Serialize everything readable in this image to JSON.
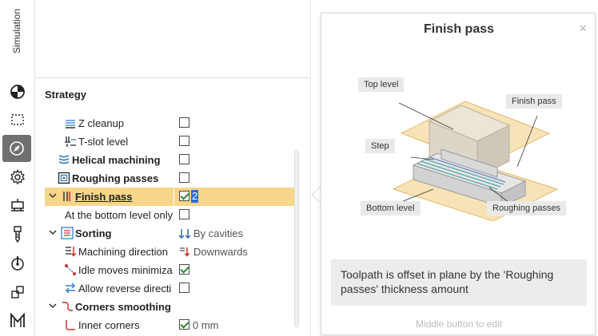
{
  "sidebar": {
    "tab_label": "Simulation",
    "icons": [
      "pie-chart-icon",
      "dashed-rectangle-icon",
      "compass-icon",
      "gear-icon",
      "machine-icon",
      "tool-icon",
      "probe-icon",
      "blocks-icon",
      "m-logo-icon"
    ]
  },
  "panel": {
    "section_title": "Strategy",
    "rows": [
      {
        "label": "Z cleanup",
        "checked": false
      },
      {
        "label": "T-slot level",
        "checked": false
      },
      {
        "label": "Helical machining",
        "checked": false
      },
      {
        "label": "Roughing passes",
        "checked": false
      },
      {
        "label": "Finish pass",
        "checked": true,
        "value": "2"
      },
      {
        "label": "At the bottom level only",
        "checked": false
      },
      {
        "label": "Sorting",
        "value": "By cavities"
      },
      {
        "label": "Machining direction",
        "value": "Downwards"
      },
      {
        "label": "Idle moves minimiza",
        "checked": true
      },
      {
        "label": "Allow reverse directi",
        "checked": false
      },
      {
        "label": "Corners smoothing"
      },
      {
        "label": "Inner corners",
        "checked": true,
        "value": "0 mm"
      }
    ]
  },
  "tooltip": {
    "title": "Finish pass",
    "close_symbol": "×",
    "labels": {
      "top_level": "Top level",
      "finish_pass": "Finish pass",
      "step": "Step",
      "bottom_level": "Bottom level",
      "roughing_passes": "Roughing passes"
    },
    "description": "Toolpath is offset in plane by the 'Roughing passes' thickness amount",
    "hint": "Middle button to edit"
  },
  "colors": {
    "selection": "#f7d58a",
    "accent_blue": "#2a6dd6",
    "check_green": "#2a8a2a"
  }
}
